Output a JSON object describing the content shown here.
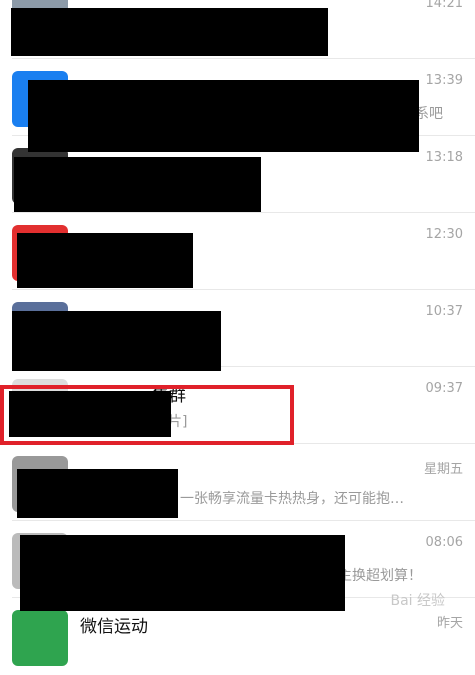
{
  "colors": {
    "highlight": "#e0212a",
    "redaction": "#000000"
  },
  "rows": [
    {
      "title": "",
      "preview": "",
      "time": "14:21"
    },
    {
      "title": "",
      "preview": "系吧",
      "time": "13:39"
    },
    {
      "title": "",
      "preview": "",
      "time": "13:18"
    },
    {
      "title": "",
      "preview": "",
      "time": "12:30"
    },
    {
      "title": "",
      "preview": "",
      "time": "10:37"
    },
    {
      "title": "售群",
      "preview": "片]",
      "time": "09:37"
    },
    {
      "title": "",
      "preview": "一张畅享流量卡热热身，还可能抱…",
      "time": "星期五"
    },
    {
      "title": "",
      "preview": "主换超划算！",
      "time": "08:06"
    },
    {
      "title": "微信运动",
      "preview": "",
      "time": "昨天"
    }
  ],
  "watermark": "Bai 经验"
}
